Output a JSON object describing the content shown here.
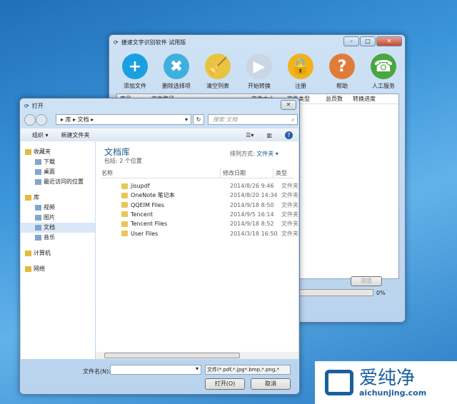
{
  "main_window": {
    "title": "捷速文字识别软件 试用版",
    "toolbar": [
      {
        "label": "添加文件",
        "icon": "plus-icon",
        "color": "#1aa0e0",
        "glyph": "+"
      },
      {
        "label": "删除选择项",
        "icon": "delete-icon",
        "color": "#3fb0dd",
        "glyph": "✖"
      },
      {
        "label": "清空列表",
        "icon": "broom-icon",
        "color": "#e8c440",
        "glyph": "🧹"
      },
      {
        "label": "开始转换",
        "icon": "play-icon",
        "color": "#c9d6e3",
        "glyph": "▶"
      },
      {
        "label": "注册",
        "icon": "lock-icon",
        "color": "#f2b21c",
        "glyph": "🔒"
      },
      {
        "label": "帮助",
        "icon": "help-book-icon",
        "color": "#e07c3a",
        "glyph": "?"
      },
      {
        "label": "人工服务",
        "icon": "phone-icon",
        "color": "#4aa640",
        "glyph": "☎"
      }
    ],
    "columns": [
      "序号",
      "文件路径",
      "文件大小",
      "文件类型",
      "总页数",
      "转换进度"
    ],
    "browse_label": "浏览",
    "progress_label": "0%",
    "progress": 0
  },
  "dialog": {
    "title": "打开",
    "breadcrumb": [
      "库",
      "文档"
    ],
    "search_placeholder": "搜索 文档",
    "organize": "组织 ▾",
    "new_folder": "新建文件夹",
    "tree": [
      {
        "label": "收藏夹",
        "level": 0
      },
      {
        "label": "下载",
        "level": 1
      },
      {
        "label": "桌面",
        "level": 1
      },
      {
        "label": "最近访问的位置",
        "level": 1
      },
      {
        "label": "库",
        "level": 0
      },
      {
        "label": "视频",
        "level": 1
      },
      {
        "label": "图片",
        "level": 1
      },
      {
        "label": "文档",
        "level": 1
      },
      {
        "label": "音乐",
        "level": 1
      },
      {
        "label": "计算机",
        "level": 0
      },
      {
        "label": "网络",
        "level": 0
      }
    ],
    "library_title": "文档库",
    "library_sub": "包括: 2 个位置",
    "sort_label": "排列方式:",
    "sort_value": "文件夹 ▾",
    "headers": [
      "名称",
      "修改日期",
      "类型"
    ],
    "files": [
      {
        "name": "jisupdf",
        "date": "2014/8/26 9:46",
        "type": "文件夹"
      },
      {
        "name": "OneNote 笔记本",
        "date": "2014/8/20 14:34",
        "type": "文件夹"
      },
      {
        "name": "QQEIM Files",
        "date": "2014/9/18 8:50",
        "type": "文件夹"
      },
      {
        "name": "Tencent",
        "date": "2014/9/5 16:14",
        "type": "文件夹"
      },
      {
        "name": "Tencent Files",
        "date": "2014/9/18 8:52",
        "type": "文件夹"
      },
      {
        "name": "User Files",
        "date": "2014/3/18 16:50",
        "type": "文件夹"
      }
    ],
    "filename_label": "文件名(N):",
    "filename_value": "",
    "filter": "文件(*.pdf,*.jpg*.bmp,*.png,*",
    "open": "打开(O)",
    "cancel": "取消"
  },
  "watermark": {
    "cn": "爱纯净",
    "url": "aichunjing.com"
  }
}
